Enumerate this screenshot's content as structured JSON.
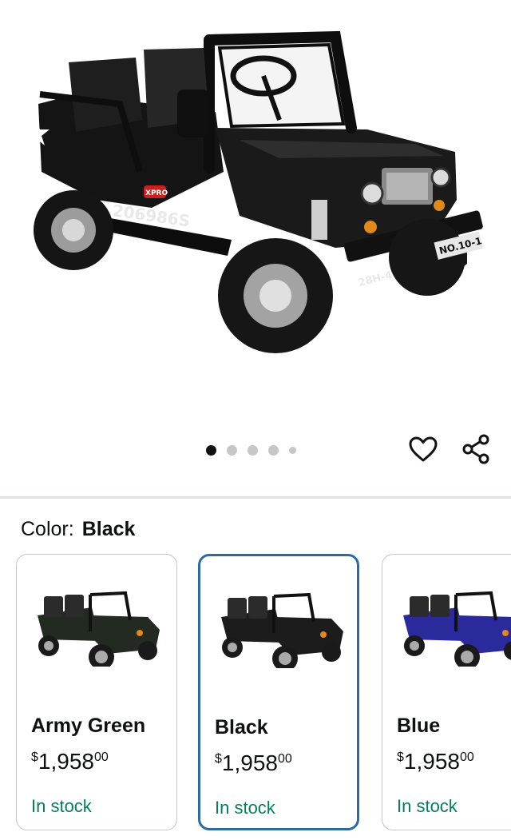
{
  "product": {
    "image_alt": "Black mini jeep go-kart",
    "decal_number": "206986S",
    "plate_front": "NO.10-1",
    "plate_side": "28H-4",
    "badge": "XPRO"
  },
  "carousel": {
    "total_dots": 5,
    "active_index": 0
  },
  "actions": {
    "wishlist_icon": "heart-outline-icon",
    "share_icon": "share-icon"
  },
  "color_selector": {
    "label": "Color:",
    "selected": "Black"
  },
  "swatches": [
    {
      "name": "Army Green",
      "currency": "$",
      "price_whole": "1,958",
      "price_cents": "00",
      "stock": "In stock",
      "body_color": "#232a22",
      "selected": false
    },
    {
      "name": "Black",
      "currency": "$",
      "price_whole": "1,958",
      "price_cents": "00",
      "stock": "In stock",
      "body_color": "#1c1c1c",
      "selected": true
    },
    {
      "name": "Blue",
      "currency": "$",
      "price_whole": "1,958",
      "price_cents": "00",
      "stock": "In stock",
      "body_color": "#2a2a9c",
      "selected": false
    }
  ],
  "colors": {
    "accent_selected": "#2c6aa2",
    "stock_green": "#067d62",
    "divider": "#dfe3e3"
  }
}
